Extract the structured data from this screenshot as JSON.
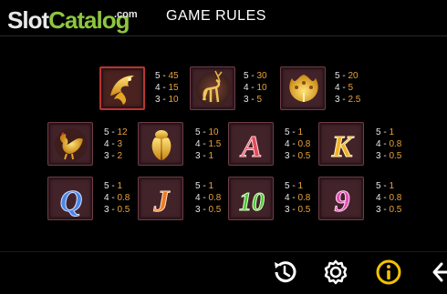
{
  "watermark": {
    "slot": "Slot",
    "catalog": "Catalog",
    "com": ".com"
  },
  "title": "GAME RULES",
  "symbols": [
    {
      "name": "phoenix",
      "pays": [
        [
          "5",
          "45"
        ],
        [
          "4",
          "15"
        ],
        [
          "3",
          "10"
        ]
      ]
    },
    {
      "name": "deer",
      "pays": [
        [
          "5",
          "30"
        ],
        [
          "4",
          "10"
        ],
        [
          "3",
          "5"
        ]
      ]
    },
    {
      "name": "peacock",
      "pays": [
        [
          "5",
          "20"
        ],
        [
          "4",
          "5"
        ],
        [
          "3",
          "2.5"
        ]
      ]
    },
    {
      "name": "rooster",
      "pays": [
        [
          "5",
          "12"
        ],
        [
          "4",
          "3"
        ],
        [
          "3",
          "2"
        ]
      ]
    },
    {
      "name": "cicada",
      "pays": [
        [
          "5",
          "10"
        ],
        [
          "4",
          "1.5"
        ],
        [
          "3",
          "1"
        ]
      ]
    },
    {
      "name": "A",
      "pays": [
        [
          "5",
          "1"
        ],
        [
          "4",
          "0.8"
        ],
        [
          "3",
          "0.5"
        ]
      ]
    },
    {
      "name": "K",
      "pays": [
        [
          "5",
          "1"
        ],
        [
          "4",
          "0.8"
        ],
        [
          "3",
          "0.5"
        ]
      ]
    },
    {
      "name": "Q",
      "pays": [
        [
          "5",
          "1"
        ],
        [
          "4",
          "0.8"
        ],
        [
          "3",
          "0.5"
        ]
      ]
    },
    {
      "name": "J",
      "pays": [
        [
          "5",
          "1"
        ],
        [
          "4",
          "0.8"
        ],
        [
          "3",
          "0.5"
        ]
      ]
    },
    {
      "name": "10",
      "pays": [
        [
          "5",
          "1"
        ],
        [
          "4",
          "0.8"
        ],
        [
          "3",
          "0.5"
        ]
      ]
    },
    {
      "name": "9",
      "pays": [
        [
          "5",
          "1"
        ],
        [
          "4",
          "0.8"
        ],
        [
          "3",
          "0.5"
        ]
      ]
    }
  ],
  "letters": {
    "A": "A",
    "K": "K",
    "Q": "Q",
    "J": "J",
    "ten": "10",
    "nine": "9"
  },
  "icons": {
    "history": "history-icon",
    "settings": "settings-icon",
    "info": "info-icon",
    "exit": "exit-icon"
  },
  "colors": {
    "pay_value": "#e9a23a",
    "pay_key": "#e8e8e8",
    "info_accent": "#f2c200",
    "watermark_green": "#8dc63f"
  }
}
